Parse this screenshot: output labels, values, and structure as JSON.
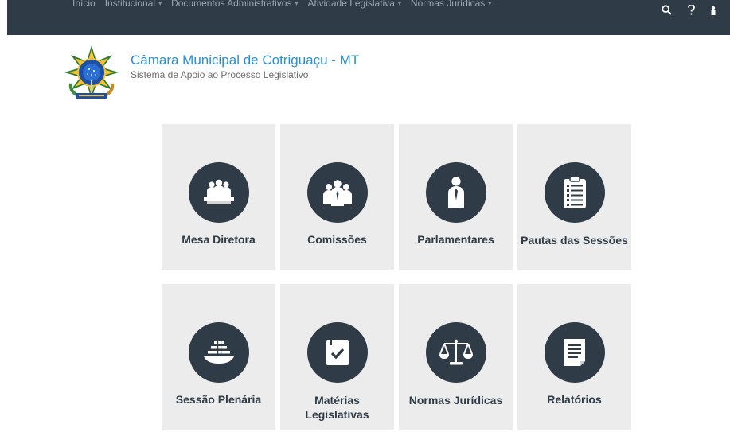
{
  "nav": {
    "items": [
      {
        "label": "Início"
      },
      {
        "label": "Institucional"
      },
      {
        "label": "Documentos Administrativos"
      },
      {
        "label": "Atividade Legislativa"
      },
      {
        "label": "Normas Jurídicas"
      }
    ],
    "caret": "▾",
    "icons": [
      "search-icon",
      "help-icon",
      "user-icon"
    ]
  },
  "brand": {
    "title": "Câmara Municipal de Cotriguaçu - MT",
    "subtitle": "Sistema de Apoio ao Processo Legislativo",
    "logo": "coat-of-arms-brazil"
  },
  "tiles": [
    {
      "label": "Mesa Diretora",
      "icon": "board-icon"
    },
    {
      "label": "Comissões",
      "icon": "committees-icon"
    },
    {
      "label": "Parlamentares",
      "icon": "parliamentarian-icon"
    },
    {
      "label": "Pautas das Sessões",
      "icon": "agenda-clipboard-icon"
    },
    {
      "label": "Sessão Plenária",
      "icon": "plenary-session-icon"
    },
    {
      "label": "Matérias Legislativas",
      "icon": "legislative-matters-icon"
    },
    {
      "label": "Normas Jurídicas",
      "icon": "scales-icon"
    },
    {
      "label": "Relatórios",
      "icon": "reports-icon"
    }
  ],
  "colors": {
    "navbar": "#2f3c47",
    "title": "#2a91cf",
    "tile_bg": "#ececec",
    "icon_circle": "#2f3c47",
    "tile_text": "#2f3c47"
  }
}
